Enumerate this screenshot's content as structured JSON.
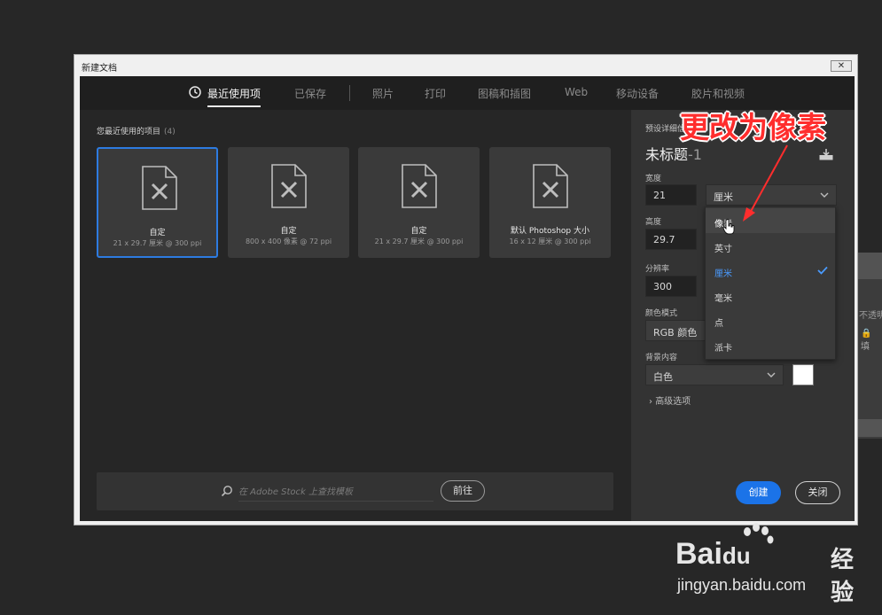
{
  "dialog": {
    "title": "新建文档",
    "close_glyph": "✕"
  },
  "tabs": [
    {
      "label": "最近使用项",
      "active": true
    },
    {
      "label": "已保存",
      "active": false
    },
    {
      "label": "照片",
      "active": false
    },
    {
      "label": "打印",
      "active": false
    },
    {
      "label": "图稿和插图",
      "active": false
    },
    {
      "label": "Web",
      "active": false
    },
    {
      "label": "移动设备",
      "active": false
    },
    {
      "label": "胶片和视频",
      "active": false
    }
  ],
  "recent": {
    "header": "您最近使用的项目",
    "count": "(4)",
    "cards": [
      {
        "name": "自定",
        "desc": "21 x 29.7 厘米 @ 300 ppi",
        "selected": true
      },
      {
        "name": "自定",
        "desc": "800 x 400 像素 @ 72 ppi",
        "selected": false
      },
      {
        "name": "自定",
        "desc": "21 x 29.7 厘米 @ 300 ppi",
        "selected": false
      },
      {
        "name": "默认 Photoshop 大小",
        "desc": "16 x 12 厘米 @ 300 ppi",
        "selected": false
      }
    ]
  },
  "stock": {
    "placeholder": "在 Adobe Stock 上查找模板",
    "go_label": "前往"
  },
  "preset": {
    "section_label": "预设详细信息",
    "doc_title": "未标题",
    "doc_suffix": "-1",
    "width_label": "宽度",
    "width_value": "21",
    "unit_value": "厘米",
    "height_label": "高度",
    "height_value": "29.7",
    "resolution_label": "分辨率",
    "resolution_value": "300",
    "color_mode_label": "颜色模式",
    "color_mode_value": "RGB 颜色",
    "background_label": "背景内容",
    "background_value": "白色",
    "background_color": "#ffffff",
    "advanced_label": "高级选项",
    "create_label": "创建",
    "close_label": "关闭"
  },
  "unit_dropdown": {
    "items": [
      {
        "label": "像素",
        "state": "hover"
      },
      {
        "label": "英寸",
        "state": "normal"
      },
      {
        "label": "厘米",
        "state": "selected"
      },
      {
        "label": "毫米",
        "state": "normal"
      },
      {
        "label": "点",
        "state": "normal"
      },
      {
        "label": "派卡",
        "state": "normal"
      }
    ]
  },
  "background_panel": {
    "text": "不透明",
    "lock": "🔒 填"
  },
  "annotation": {
    "text": "更改为像素"
  },
  "watermark": {
    "logo": "Bai",
    "logo_du": "du",
    "jingyan": "经验",
    "url": "jingyan.baidu.com"
  },
  "colors": {
    "accent": "#1b73e8",
    "selected_border": "#2d7be0",
    "annotation_red": "#ff2d2d",
    "dialog_bg": "#1f1f1f"
  }
}
